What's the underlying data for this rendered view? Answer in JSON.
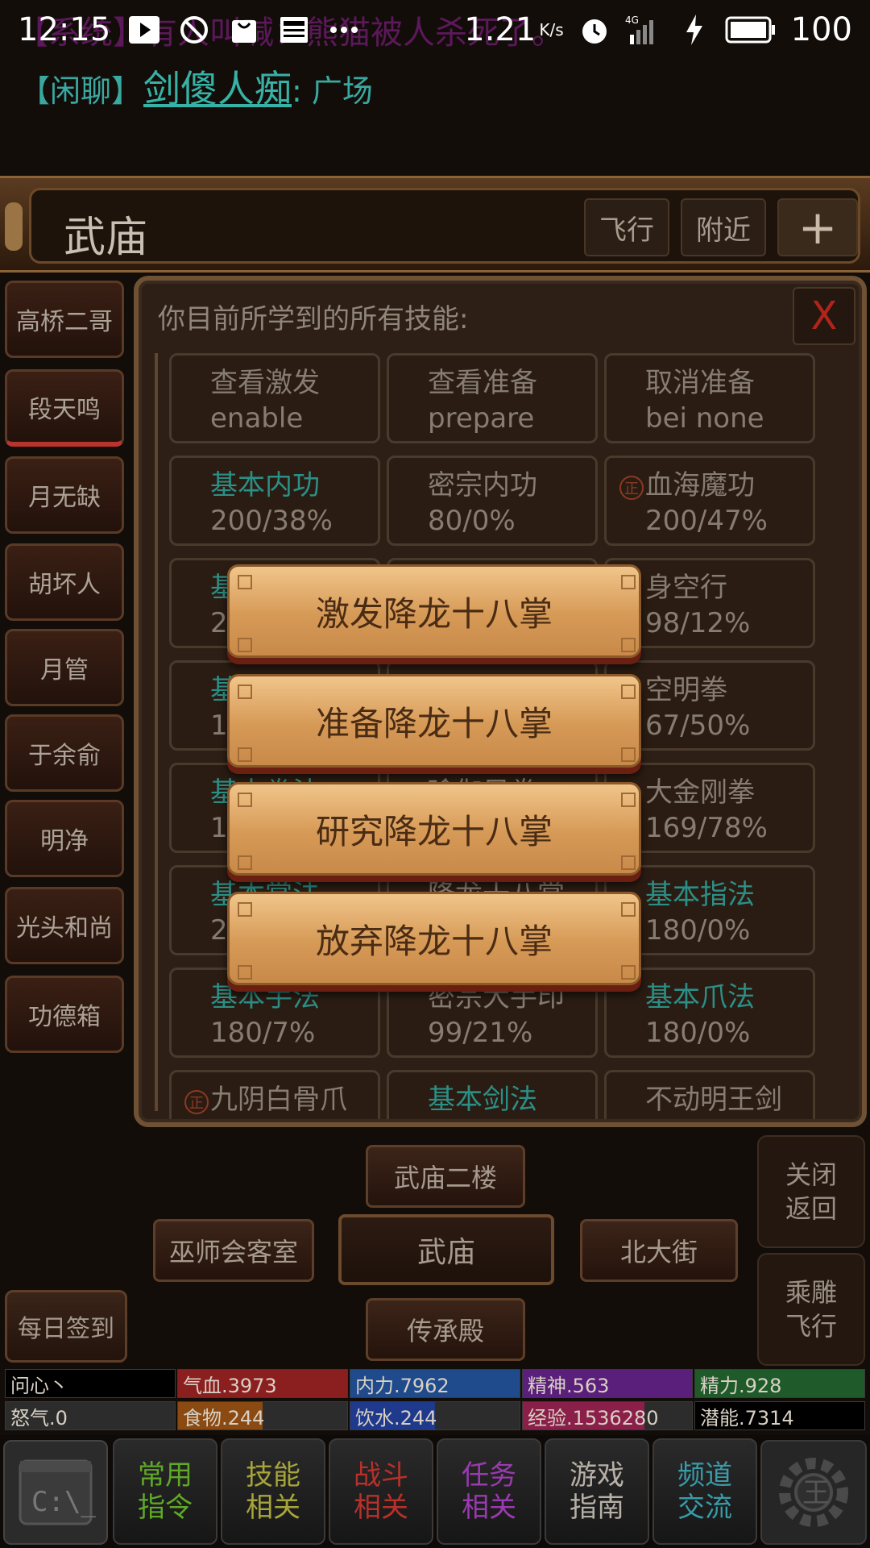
{
  "status_bar": {
    "time": "12:15",
    "speed": "1.21",
    "speed_unit": "K/s",
    "network": "4G",
    "battery": "100"
  },
  "chat": {
    "background_message": "【系统】有人叫喊：熊猫被人杀死了。",
    "channel": "【闲聊】",
    "player": "剑傻人痴",
    "text": "广场"
  },
  "location": {
    "title": "武庙",
    "fly_label": "飞行",
    "nearby_label": "附近",
    "plus_label": "+"
  },
  "npcs": [
    "高桥二哥",
    "段天鸣",
    "月无缺",
    "胡坏人",
    "月管",
    "于余俞",
    "明净",
    "光头和尚",
    "功德箱"
  ],
  "skills_panel": {
    "title": "你目前所学到的所有技能:",
    "close_label": "X",
    "zheng_char": "正",
    "commands": [
      {
        "name": "查看激发",
        "cmd": "enable"
      },
      {
        "name": "查看准备",
        "cmd": "prepare"
      },
      {
        "name": "取消准备",
        "cmd": "bei none"
      }
    ],
    "skills": [
      {
        "name": "基本内功",
        "value": "200/38%",
        "teal": true,
        "zheng": false
      },
      {
        "name": "密宗内功",
        "value": "80/0%",
        "teal": false,
        "zheng": false
      },
      {
        "name": "血海魔功",
        "value": "200/47%",
        "teal": false,
        "zheng": true
      },
      {
        "name": "基",
        "value": "20",
        "teal": true,
        "zheng": false
      },
      {
        "name": "",
        "value": "",
        "teal": false,
        "zheng": false
      },
      {
        "name": "身空行",
        "value": "98/12%",
        "teal": false,
        "zheng": false
      },
      {
        "name": "基",
        "value": "18",
        "teal": true,
        "zheng": false
      },
      {
        "name": "",
        "value": "",
        "teal": false,
        "zheng": false
      },
      {
        "name": "空明拳",
        "value": "67/50%",
        "teal": false,
        "zheng": false
      },
      {
        "name": "基本拳法",
        "value": "18",
        "teal": true,
        "zheng": false
      },
      {
        "name": "瑜伽风拳",
        "value": "",
        "teal": false,
        "zheng": false
      },
      {
        "name": "大金刚拳",
        "value": "169/78%",
        "teal": false,
        "zheng": false
      },
      {
        "name": "基本掌法",
        "value": "20",
        "teal": true,
        "zheng": false
      },
      {
        "name": "降龙十八掌",
        "value": "",
        "teal": false,
        "zheng": false
      },
      {
        "name": "基本指法",
        "value": "180/0%",
        "teal": true,
        "zheng": false
      },
      {
        "name": "基本手法",
        "value": "180/7%",
        "teal": true,
        "zheng": false
      },
      {
        "name": "密宗大手印",
        "value": "99/21%",
        "teal": false,
        "zheng": false
      },
      {
        "name": "基本爪法",
        "value": "180/0%",
        "teal": true,
        "zheng": false
      },
      {
        "name": "九阴白骨爪",
        "value": "",
        "teal": false,
        "zheng": true
      },
      {
        "name": "基本剑法",
        "value": "",
        "teal": true,
        "zheng": false
      },
      {
        "name": "不动明王剑",
        "value": "",
        "teal": false,
        "zheng": false
      }
    ]
  },
  "actions": [
    "激发降龙十八掌",
    "准备降龙十八掌",
    "研究降龙十八掌",
    "放弃降龙十八掌"
  ],
  "navigation": {
    "north": "武庙二楼",
    "west": "巫师会客室",
    "center": "武庙",
    "east": "北大街",
    "south": "传承殿",
    "close_back": "关闭\n返回",
    "ride_fly": "乘雕\n飞行",
    "daily_sign": "每日签到"
  },
  "stats": [
    {
      "label": "问心丶",
      "fill": 1.0,
      "color": "#000000"
    },
    {
      "label": "气血.3973",
      "fill": 1.0,
      "color": "#8b1f1f"
    },
    {
      "label": "内力.7962",
      "fill": 1.0,
      "color": "#1f4a8c"
    },
    {
      "label": "精神.563",
      "fill": 1.0,
      "color": "#5a1f7a"
    },
    {
      "label": "精力.928",
      "fill": 1.0,
      "color": "#1f5a2a"
    },
    {
      "label": "怒气.0",
      "fill": 0.0,
      "color": "#555555"
    },
    {
      "label": "食物.244",
      "fill": 0.5,
      "color": "#8a4a12"
    },
    {
      "label": "饮水.244",
      "fill": 0.5,
      "color": "#1f3a8c"
    },
    {
      "label": "经验.1536280",
      "fill": 0.72,
      "color": "#8a1f4a"
    },
    {
      "label": "潜能.7314",
      "fill": 1.0,
      "color": "#000000"
    }
  ],
  "bottom_menu": [
    {
      "label": "常用\n指令",
      "color": "#5fa828"
    },
    {
      "label": "技能\n相关",
      "color": "#a7a53a"
    },
    {
      "label": "战斗\n相关",
      "color": "#b8302a"
    },
    {
      "label": "任务\n相关",
      "color": "#9a3ab0"
    },
    {
      "label": "游戏\n指南",
      "color": "#b7b0a6"
    },
    {
      "label": "频道\n交流",
      "color": "#3a9aa8"
    }
  ]
}
